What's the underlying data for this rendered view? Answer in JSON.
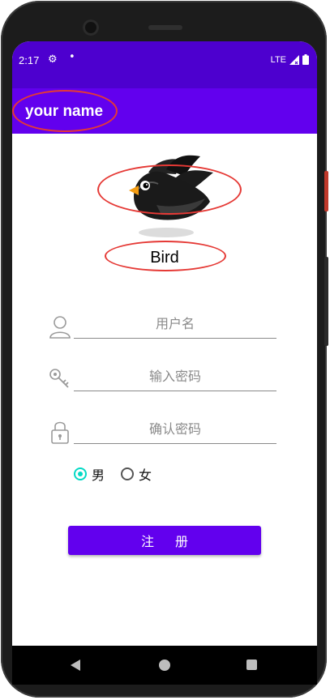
{
  "status_bar": {
    "time": "2:17",
    "network": "LTE"
  },
  "app_bar": {
    "title": "your name"
  },
  "profile": {
    "name": "Bird"
  },
  "form": {
    "username_placeholder": "用户名",
    "password_placeholder": "输入密码",
    "confirm_placeholder": "确认密码"
  },
  "gender": {
    "male_label": "男",
    "female_label": "女",
    "selected": "male"
  },
  "register_button": {
    "label": "注册"
  },
  "colors": {
    "status_bar": "#4d00cf",
    "app_bar": "#6200ee",
    "accent": "#03dac5",
    "annotation": "#e53935"
  },
  "icons": [
    "settings-icon",
    "signal-icon",
    "battery-icon",
    "person-icon",
    "key-icon",
    "lock-icon",
    "back-icon",
    "home-icon",
    "recents-icon"
  ]
}
